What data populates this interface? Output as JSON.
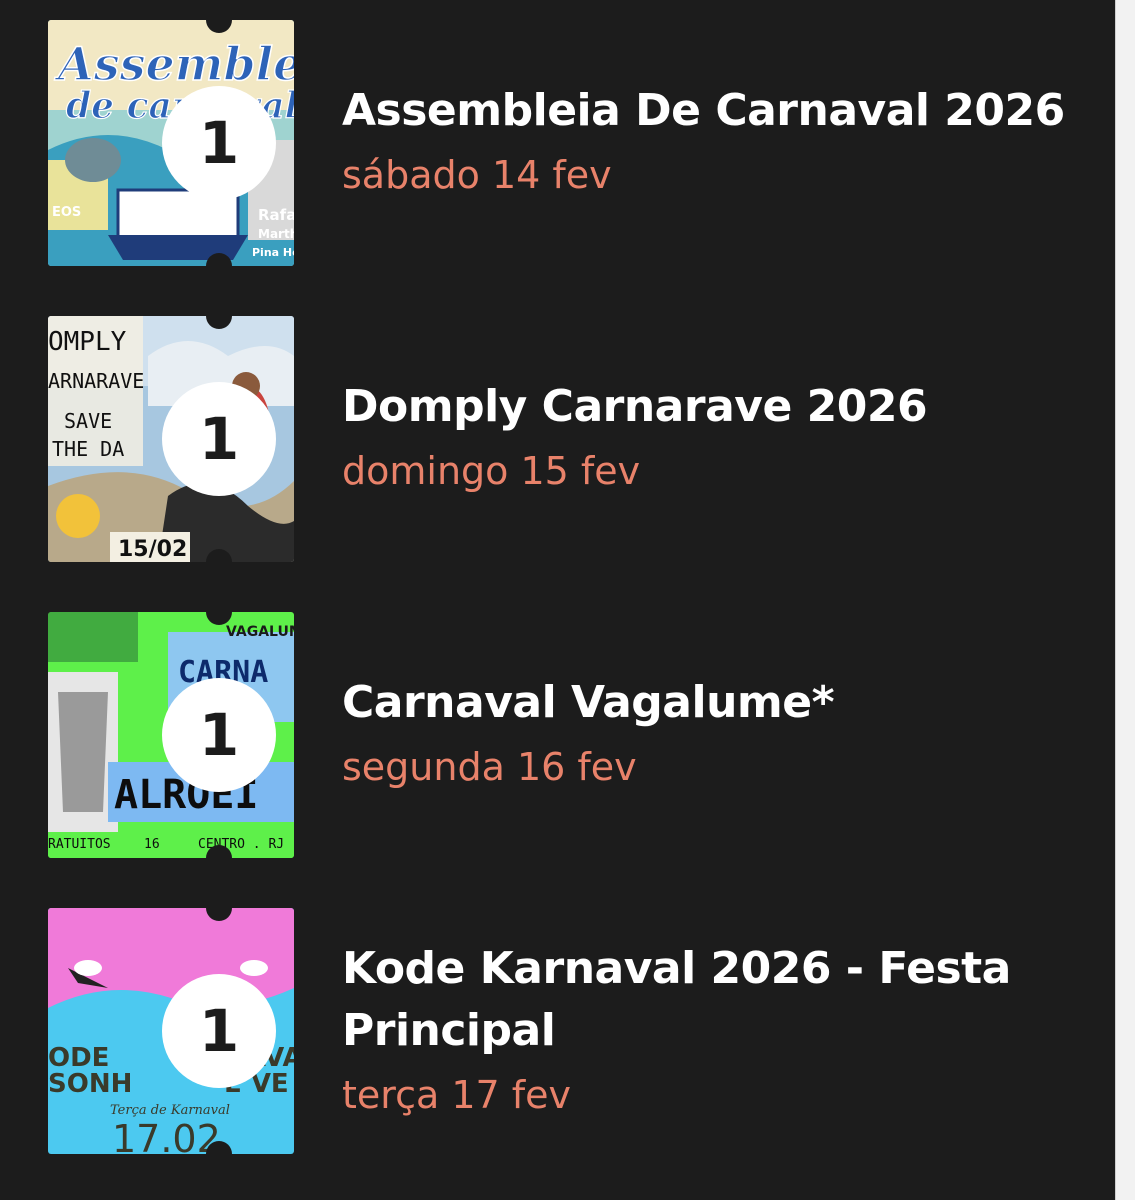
{
  "events": [
    {
      "title": "Assembleia De Carnaval 2026",
      "date": "sábado 14 fev",
      "quantity": "1",
      "thumb_theme": "assembleia",
      "thumb_texts": [
        "Assembleia",
        "de carnaval",
        "Rafa",
        "Marth",
        "Pina He",
        "EOS"
      ]
    },
    {
      "title": "Domply Carnarave 2026",
      "date": "domingo 15 fev",
      "quantity": "1",
      "thumb_theme": "domply",
      "thumb_texts": [
        "OMPLY",
        "ARNARAVE",
        "SAVE",
        "THE DA",
        "15/02"
      ]
    },
    {
      "title": "Carnaval Vagalume*",
      "date": "segunda 16 fev",
      "quantity": "1",
      "thumb_theme": "vagalume",
      "thumb_texts": [
        "VAGALUM",
        "CARNA",
        "ALROEI",
        "RATUITOS",
        "16",
        "CENTRO . RJ"
      ]
    },
    {
      "title": "Kode Karnaval 2026 - Festa Principal",
      "date": "terça 17 fev",
      "quantity": "1",
      "thumb_theme": "kode",
      "thumb_texts": [
        "ODE",
        "NAVA",
        "SONH",
        "E VE",
        "Terça de Karnaval",
        "17.02"
      ]
    }
  ],
  "colors": {
    "background": "#1c1c1c",
    "title": "#ffffff",
    "date_accent": "#e8826a",
    "scrollbar_track": "#f2f2f2"
  }
}
